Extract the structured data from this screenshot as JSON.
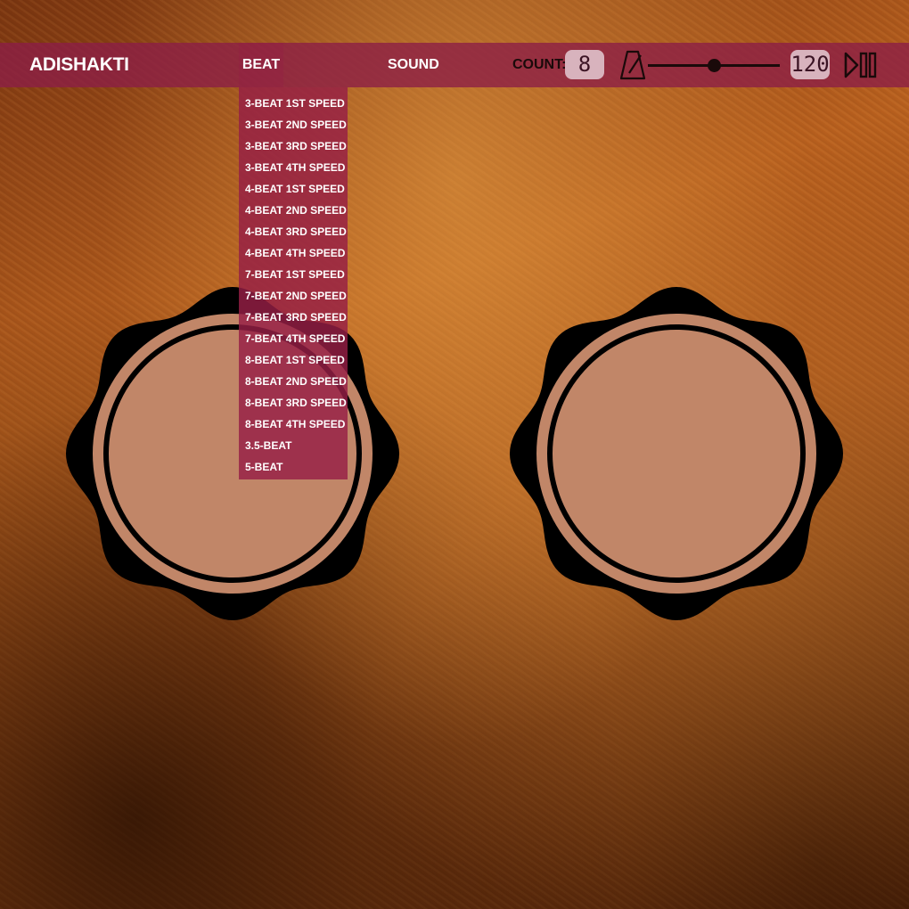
{
  "app": {
    "brand": "ADISHAKTI"
  },
  "nav": {
    "beat_label": "BEAT",
    "sound_label": "SOUND",
    "count_label": "COUNT:",
    "count_value": "8",
    "bpm_value": "120",
    "tempo_slider_fraction": 0.5
  },
  "beat_menu": {
    "items": [
      "3-BEAT 1ST SPEED",
      "3-BEAT 2ND SPEED",
      "3-BEAT 3RD SPEED",
      "3-BEAT 4TH SPEED",
      "4-BEAT 1ST SPEED",
      "4-BEAT 2ND SPEED",
      "4-BEAT 3RD SPEED",
      "4-BEAT 4TH SPEED",
      "7-BEAT 1ST SPEED",
      "7-BEAT 2ND SPEED",
      "7-BEAT 3RD SPEED",
      "7-BEAT 4TH SPEED",
      "8-BEAT 1ST SPEED",
      "8-BEAT 2ND SPEED",
      "8-BEAT 3RD SPEED",
      "8-BEAT 4TH SPEED",
      "3.5-BEAT",
      "5-BEAT"
    ]
  },
  "icons": {
    "metronome": "metronome-icon",
    "play_pause": "play-pause-icon"
  },
  "colors": {
    "navbar": "#8c1e46",
    "drum_head": "#c18668",
    "drum_rim": "#000000",
    "lcd_bg": "#d8b3bd"
  }
}
